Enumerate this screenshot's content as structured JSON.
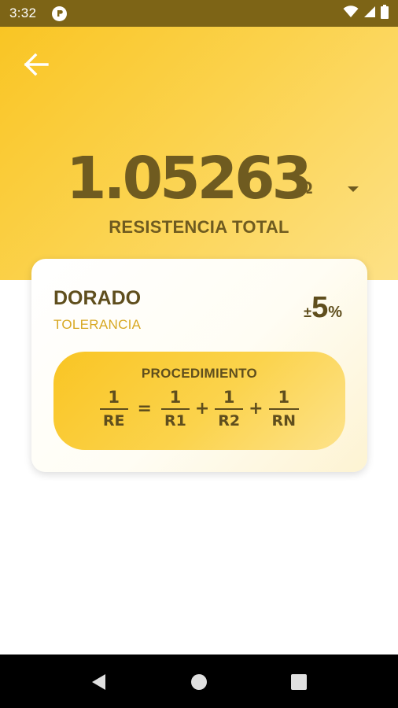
{
  "status_bar": {
    "time": "3:32",
    "icons": [
      "app-notification-icon",
      "wifi-icon",
      "cell-signal-icon",
      "battery-icon"
    ]
  },
  "header": {
    "back_icon": "arrow-left-icon",
    "result_value": "1.05263",
    "result_unit": "Ω",
    "unit_dropdown_icon": "caret-down-icon",
    "result_label": "RESISTENCIA TOTAL"
  },
  "card": {
    "band_name": "DORADO",
    "band_sub": "TOLERANCIA",
    "tolerance": {
      "prefix": "±",
      "value": "5",
      "suffix": "%"
    },
    "procedure": {
      "title": "PROCEDIMIENTO",
      "formula": {
        "lhs": {
          "num": "1",
          "den": "RE"
        },
        "equals": "=",
        "terms": [
          {
            "num": "1",
            "den": "R1"
          },
          {
            "num": "1",
            "den": "R2"
          },
          {
            "num": "1",
            "den": "RN"
          }
        ],
        "plus": "+"
      }
    }
  },
  "nav_bar": {
    "icons": [
      "back-triangle-icon",
      "home-circle-icon",
      "recents-square-icon"
    ]
  },
  "colors": {
    "status_bar": "#7d6416",
    "accent": "#f9c524",
    "text_dark": "#6f5b20",
    "tolerance_label": "#d8a823"
  }
}
